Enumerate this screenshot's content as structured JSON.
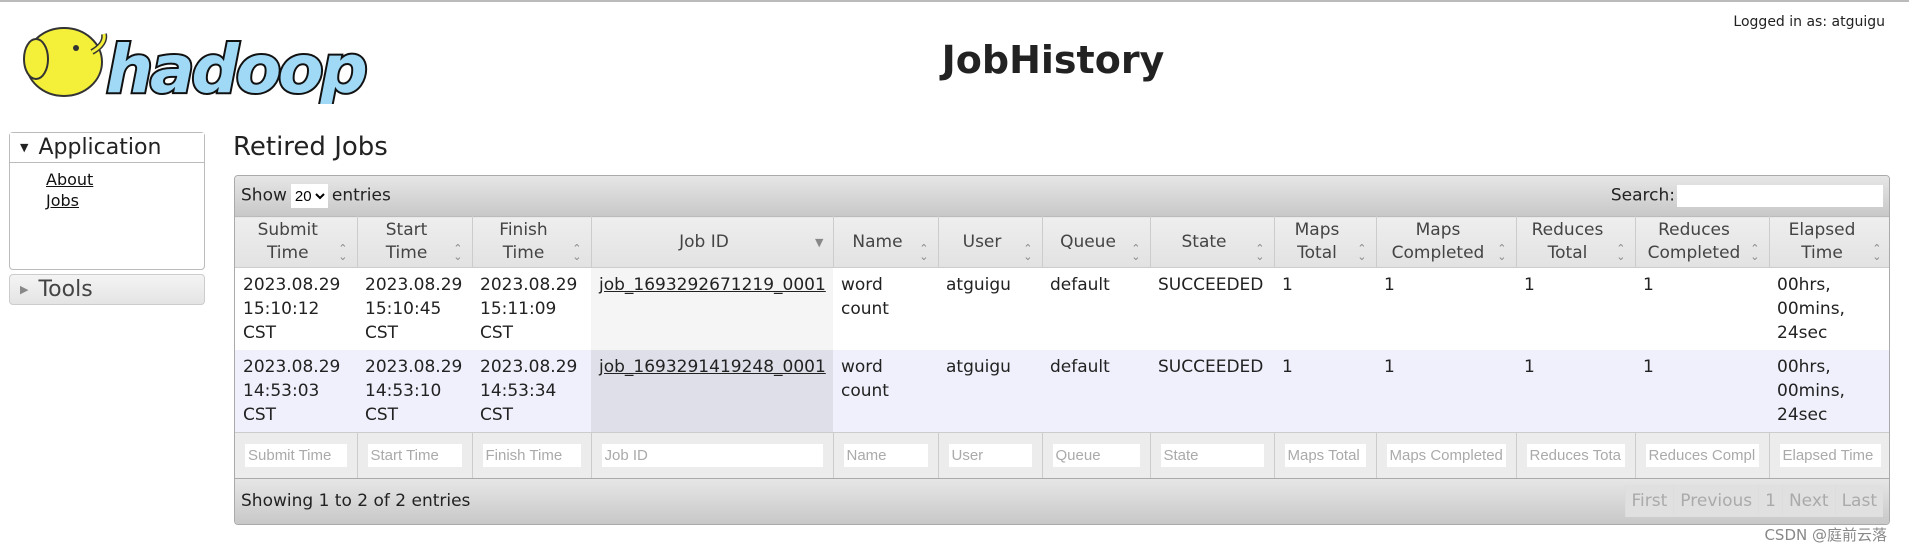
{
  "header": {
    "logo_text": "hadoop",
    "title": "JobHistory",
    "logged_in": "Logged in as: atguigu"
  },
  "sidebar": {
    "application": "Application",
    "items": [
      {
        "label": "About"
      },
      {
        "label": "Jobs"
      }
    ],
    "tools": "Tools"
  },
  "main": {
    "heading": "Retired Jobs",
    "show": "Show",
    "entries_value": "20",
    "entries": "entries",
    "search_label": "Search:",
    "search_value": "",
    "columns": [
      {
        "label": "Submit Time"
      },
      {
        "label": "Start Time"
      },
      {
        "label": "Finish Time"
      },
      {
        "label": "Job ID"
      },
      {
        "label": "Name"
      },
      {
        "label": "User"
      },
      {
        "label": "Queue"
      },
      {
        "label": "State"
      },
      {
        "label": "Maps Total"
      },
      {
        "label": "Maps Completed"
      },
      {
        "label": "Reduces Total"
      },
      {
        "label": "Reduces Completed"
      },
      {
        "label": "Elapsed Time"
      }
    ],
    "rows": [
      [
        "2023.08.29 15:10:12 CST",
        "2023.08.29 15:10:45 CST",
        "2023.08.29 15:11:09 CST",
        "job_1693292671219_0001",
        "word count",
        "atguigu",
        "default",
        "SUCCEEDED",
        "1",
        "1",
        "1",
        "1",
        "00hrs, 00mins, 24sec"
      ],
      [
        "2023.08.29 14:53:03 CST",
        "2023.08.29 14:53:10 CST",
        "2023.08.29 14:53:34 CST",
        "job_1693291419248_0001",
        "word count",
        "atguigu",
        "default",
        "SUCCEEDED",
        "1",
        "1",
        "1",
        "1",
        "00hrs, 00mins, 24sec"
      ]
    ],
    "info": "Showing 1 to 2 of 2 entries",
    "pagination": [
      "First",
      "Previous",
      "1",
      "Next",
      "Last"
    ]
  },
  "watermark": "CSDN @庭前云落"
}
